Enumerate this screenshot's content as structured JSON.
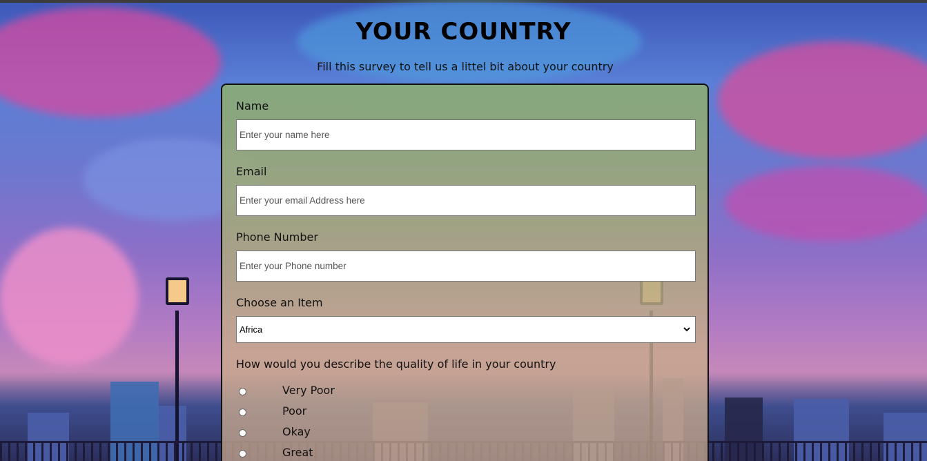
{
  "header": {
    "title": "YOUR COUNTRY",
    "subtitle": "Fill this survey to tell us a littel bit about your country"
  },
  "form": {
    "name": {
      "label": "Name",
      "placeholder": "Enter your name here"
    },
    "email": {
      "label": "Email",
      "placeholder": "Enter your email Address here"
    },
    "phone": {
      "label": "Phone Number",
      "placeholder": "Enter your Phone number"
    },
    "item": {
      "label": "Choose an Item",
      "selected": "Africa"
    },
    "quality": {
      "question": "How would you describe the quality of life in your country",
      "options": [
        "Very Poor",
        "Poor",
        "Okay",
        "Great"
      ]
    }
  },
  "colors": {
    "card_border": "#111111",
    "title": "#000000"
  }
}
